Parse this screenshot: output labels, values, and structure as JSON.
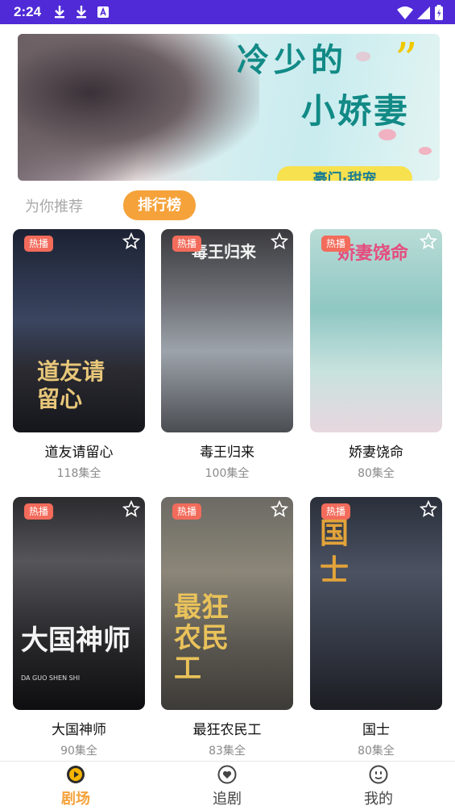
{
  "status_bar": {
    "time": "2:24",
    "bg_color": "#4f2ad6",
    "left_icons": [
      "download-icon",
      "download-icon",
      "app-notification-icon"
    ],
    "right_icons": [
      "wifi-icon",
      "signal-icon",
      "battery-charging-icon"
    ]
  },
  "banner": {
    "title_line1": "冷少的",
    "title_line2": "小娇妻",
    "tag": "豪门·甜宠",
    "quote_mark": "”"
  },
  "tabs": {
    "recommend": "为你推荐",
    "ranking": "排行榜",
    "active": "ranking",
    "accent_color": "#f5a23a"
  },
  "cards": [
    {
      "title": "道友请留心",
      "episodes": "118集全",
      "badge": "热播",
      "art": "道友请留心"
    },
    {
      "title": "毒王归来",
      "episodes": "100集全",
      "badge": "热播",
      "art": "毒王归来"
    },
    {
      "title": "娇妻饶命",
      "episodes": "80集全",
      "badge": "热播",
      "art": "娇妻饶命"
    },
    {
      "title": "大国神师",
      "episodes": "90集全",
      "badge": "热播",
      "art": "大国神师",
      "art_sub": "DA GUO SHEN SHI"
    },
    {
      "title": "最狂农民工",
      "episodes": "83集全",
      "badge": "热播",
      "art": "最狂农民工"
    },
    {
      "title": "国士",
      "episodes": "80集全",
      "badge": "热播",
      "art": "国士"
    }
  ],
  "bottom_nav": {
    "items": [
      {
        "label": "剧场",
        "icon": "theater-icon",
        "active": true
      },
      {
        "label": "追剧",
        "icon": "heart-icon",
        "active": false
      },
      {
        "label": "我的",
        "icon": "smiley-icon",
        "active": false
      }
    ]
  }
}
